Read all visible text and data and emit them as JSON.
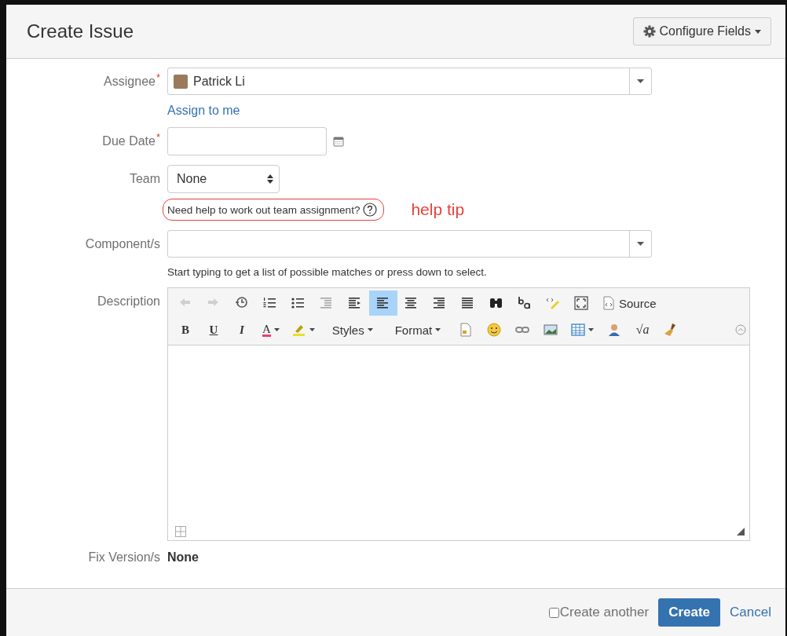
{
  "dialog": {
    "title": "Create Issue",
    "configure_button": "Configure Fields"
  },
  "assignee": {
    "label": "Assignee",
    "required_mark": "*",
    "value": "Patrick Li",
    "link": "Assign to me"
  },
  "due_date": {
    "label": "Due Date",
    "required_mark": "*"
  },
  "team": {
    "label": "Team",
    "value": "None",
    "help": "Need help to work out team assignment?",
    "annotation": "help tip"
  },
  "components": {
    "label": "Component/s",
    "hint": "Start typing to get a list of possible matches or press down to select."
  },
  "description": {
    "label": "Description",
    "row_1": [
      {
        "selected": false,
        "disabled": true
      },
      {
        "selected": false,
        "disabled": true
      },
      {
        "selected": false,
        "disabled": false
      },
      {
        "selected": false,
        "disabled": false
      },
      {
        "selected": false,
        "disabled": false
      },
      {
        "selected": false,
        "disabled": true
      },
      {
        "selected": false,
        "disabled": false
      },
      {
        "selected": true,
        "disabled": false
      },
      {
        "selected": false,
        "disabled": false
      },
      {
        "selected": false,
        "disabled": false
      },
      {
        "selected": false,
        "disabled": false
      },
      {
        "selected": false,
        "disabled": false
      },
      {
        "selected": false,
        "disabled": false
      },
      {
        "selected": false,
        "disabled": false
      },
      {
        "selected": false,
        "disabled": false
      },
      {
        "selected": false,
        "disabled": false,
        "label": "Source"
      }
    ],
    "row_2": [
      {
        "selected": false,
        "disabled": false,
        "label": "B"
      },
      {
        "selected": false,
        "disabled": false,
        "label": "U"
      },
      {
        "selected": false,
        "disabled": false,
        "label": "I"
      },
      {
        "selected": false,
        "disabled": false,
        "label": "A",
        "dropdown": true
      },
      {
        "selected": false,
        "disabled": false,
        "dropdown": true
      },
      {
        "selected": false,
        "disabled": false,
        "label": "Styles",
        "dropdown": true
      },
      {
        "selected": false,
        "disabled": false,
        "label": "Format",
        "dropdown": true
      },
      {
        "selected": false,
        "disabled": false
      },
      {
        "selected": false,
        "disabled": false
      },
      {
        "selected": false,
        "disabled": false
      },
      {
        "selected": false,
        "disabled": false
      },
      {
        "selected": false,
        "disabled": false,
        "dropdown": true
      },
      {
        "selected": false,
        "disabled": false
      },
      {
        "selected": false,
        "disabled": false,
        "label": "√a"
      },
      {
        "selected": false,
        "disabled": false
      }
    ]
  },
  "fix_version": {
    "label": "Fix Version/s",
    "value": "None"
  },
  "footer": {
    "create_another": {
      "label": "Create another",
      "checked": false
    },
    "create": "Create",
    "cancel": "Cancel"
  }
}
